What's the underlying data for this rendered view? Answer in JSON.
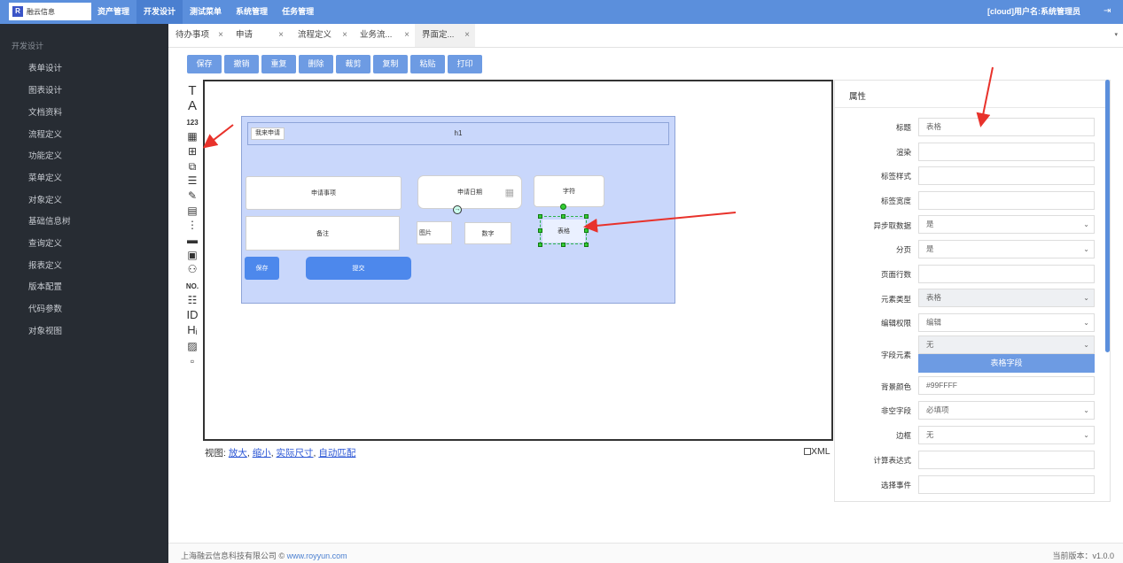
{
  "topbar": {
    "logo_mark": "R",
    "logo_text": "融云信息",
    "nav": [
      "资产管理",
      "开发设计",
      "测试菜单",
      "系统管理",
      "任务管理"
    ],
    "active_nav_index": 1,
    "user_info": "[cloud]用户名:系统管理员",
    "logout_icon": "logout-icon"
  },
  "sidebar": {
    "heading": "开发设计",
    "items": [
      "表单设计",
      "图表设计",
      "文档资料",
      "流程定义",
      "功能定义",
      "菜单定义",
      "对象定义",
      "基础信息树",
      "查询定义",
      "报表定义",
      "版本配置",
      "代码参数",
      "对象视图"
    ]
  },
  "tabs": {
    "items": [
      "待办事项",
      "申请",
      "流程定义",
      "业务流...",
      "界面定..."
    ],
    "active_index": 4,
    "close": "×",
    "menu_icon": "▾"
  },
  "toolbar": {
    "buttons": [
      "保存",
      "撤销",
      "重复",
      "删除",
      "裁剪",
      "复制",
      "粘贴",
      "打印"
    ]
  },
  "palette": [
    "T",
    "A",
    "123",
    "▦",
    "⊞",
    "⧉",
    "☰",
    "✎",
    "▤",
    "⋮",
    "▬",
    "▣",
    "⚇",
    "NO.",
    "☷",
    "ID",
    "Hᵢ",
    "▨",
    "▫"
  ],
  "canvas": {
    "h1_badge": "我来申请",
    "h1_text": "h1",
    "fields": {
      "shenqing_shixiang": "申请事项",
      "shenqing_riqi": "申请日期",
      "zifu": "字符",
      "beizhu": "备注",
      "tupian": "图片",
      "shuzi": "数字",
      "biaoge": "表格",
      "save": "保存",
      "submit": "提交"
    }
  },
  "view": {
    "label": "视图:",
    "zoom_in": "放大",
    "zoom_out": "缩小",
    "actual": "实际尺寸",
    "auto": "自动匹配",
    "xml": "XML"
  },
  "props": {
    "title": "属性",
    "rows": [
      {
        "label": "标题",
        "value": "表格",
        "kind": "text"
      },
      {
        "label": "渲染",
        "value": "",
        "kind": "text"
      },
      {
        "label": "标签样式",
        "value": "",
        "kind": "text"
      },
      {
        "label": "标签宽度",
        "value": "",
        "kind": "text"
      },
      {
        "label": "异步取数据",
        "value": "是",
        "kind": "select"
      },
      {
        "label": "分页",
        "value": "是",
        "kind": "select"
      },
      {
        "label": "页面行数",
        "value": "",
        "kind": "text"
      },
      {
        "label": "元素类型",
        "value": "表格",
        "kind": "select-grey"
      },
      {
        "label": "编辑权限",
        "value": "编辑",
        "kind": "select"
      }
    ],
    "field_element_label": "字段元素",
    "field_element_value": "无",
    "field_element_button": "表格字段",
    "rows2": [
      {
        "label": "背景颜色",
        "value": "#99FFFF",
        "kind": "text"
      },
      {
        "label": "非空字段",
        "value": "必填项",
        "kind": "select"
      },
      {
        "label": "边框",
        "value": "无",
        "kind": "select"
      },
      {
        "label": "计算表达式",
        "value": "",
        "kind": "text"
      },
      {
        "label": "选择事件",
        "value": "",
        "kind": "text"
      }
    ]
  },
  "footer": {
    "company": "上海融云信息科技有限公司 © ",
    "link": "www.royyun.com",
    "version": "当前版本：v1.0.0"
  }
}
